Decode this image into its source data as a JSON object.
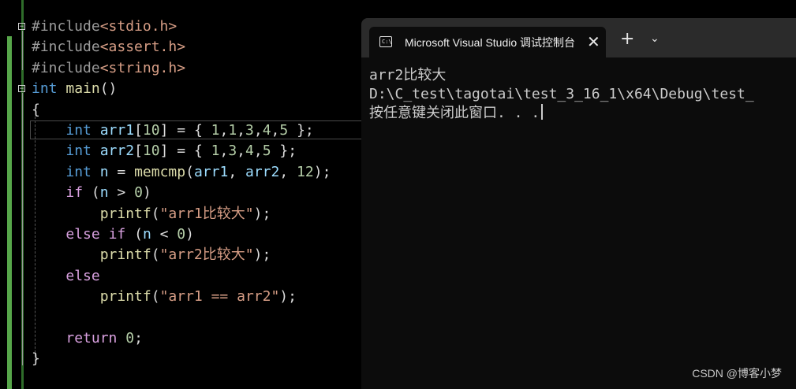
{
  "editor": {
    "lines": [
      {
        "parts": [
          [
            "pp",
            "#include"
          ],
          [
            "inc",
            "<stdio.h>"
          ]
        ]
      },
      {
        "parts": [
          [
            "pp",
            "#include"
          ],
          [
            "inc",
            "<assert.h>"
          ]
        ]
      },
      {
        "parts": [
          [
            "pp",
            "#include"
          ],
          [
            "inc",
            "<string.h>"
          ]
        ]
      },
      {
        "parts": [
          [
            "kw",
            "int"
          ],
          [
            "pun",
            " "
          ],
          [
            "fn",
            "main"
          ],
          [
            "pun",
            "()"
          ]
        ]
      },
      {
        "parts": [
          [
            "pun",
            "{"
          ]
        ]
      },
      {
        "parts": [
          [
            "pun",
            "    "
          ],
          [
            "kw",
            "int"
          ],
          [
            "pun",
            " "
          ],
          [
            "var",
            "arr1"
          ],
          [
            "pun",
            "["
          ],
          [
            "num",
            "10"
          ],
          [
            "pun",
            "] = { "
          ],
          [
            "num",
            "1"
          ],
          [
            "pun",
            ","
          ],
          [
            "num",
            "1"
          ],
          [
            "pun",
            ","
          ],
          [
            "num",
            "3"
          ],
          [
            "pun",
            ","
          ],
          [
            "num",
            "4"
          ],
          [
            "pun",
            ","
          ],
          [
            "num",
            "5"
          ],
          [
            "pun",
            " };"
          ]
        ]
      },
      {
        "parts": [
          [
            "pun",
            "    "
          ],
          [
            "kw",
            "int"
          ],
          [
            "pun",
            " "
          ],
          [
            "var",
            "arr2"
          ],
          [
            "pun",
            "["
          ],
          [
            "num",
            "10"
          ],
          [
            "pun",
            "] = { "
          ],
          [
            "num",
            "1"
          ],
          [
            "pun",
            ","
          ],
          [
            "num",
            "3"
          ],
          [
            "pun",
            ","
          ],
          [
            "num",
            "4"
          ],
          [
            "pun",
            ","
          ],
          [
            "num",
            "5"
          ],
          [
            "pun",
            " };"
          ]
        ]
      },
      {
        "parts": [
          [
            "pun",
            "    "
          ],
          [
            "kw",
            "int"
          ],
          [
            "pun",
            " "
          ],
          [
            "var",
            "n"
          ],
          [
            "pun",
            " = "
          ],
          [
            "fn",
            "memcmp"
          ],
          [
            "pun",
            "("
          ],
          [
            "var",
            "arr1"
          ],
          [
            "pun",
            ", "
          ],
          [
            "var",
            "arr2"
          ],
          [
            "pun",
            ", "
          ],
          [
            "num",
            "12"
          ],
          [
            "pun",
            ");"
          ]
        ]
      },
      {
        "parts": [
          [
            "pun",
            "    "
          ],
          [
            "ctrl",
            "if"
          ],
          [
            "pun",
            " ("
          ],
          [
            "var",
            "n"
          ],
          [
            "pun",
            " > "
          ],
          [
            "num",
            "0"
          ],
          [
            "pun",
            ")"
          ]
        ]
      },
      {
        "parts": [
          [
            "pun",
            "        "
          ],
          [
            "fn",
            "printf"
          ],
          [
            "pun",
            "("
          ],
          [
            "str",
            "\"arr1比较大\""
          ],
          [
            "pun",
            ");"
          ]
        ]
      },
      {
        "parts": [
          [
            "pun",
            "    "
          ],
          [
            "ctrl",
            "else"
          ],
          [
            "pun",
            " "
          ],
          [
            "ctrl",
            "if"
          ],
          [
            "pun",
            " ("
          ],
          [
            "var",
            "n"
          ],
          [
            "pun",
            " < "
          ],
          [
            "num",
            "0"
          ],
          [
            "pun",
            ")"
          ]
        ]
      },
      {
        "parts": [
          [
            "pun",
            "        "
          ],
          [
            "fn",
            "printf"
          ],
          [
            "pun",
            "("
          ],
          [
            "str",
            "\"arr2比较大\""
          ],
          [
            "pun",
            ");"
          ]
        ]
      },
      {
        "parts": [
          [
            "pun",
            "    "
          ],
          [
            "ctrl",
            "else"
          ]
        ]
      },
      {
        "parts": [
          [
            "pun",
            "        "
          ],
          [
            "fn",
            "printf"
          ],
          [
            "pun",
            "("
          ],
          [
            "str",
            "\"arr1 == arr2\""
          ],
          [
            "pun",
            ");"
          ]
        ]
      },
      {
        "parts": []
      },
      {
        "parts": [
          [
            "pun",
            "    "
          ],
          [
            "ctrl",
            "return"
          ],
          [
            "pun",
            " "
          ],
          [
            "num",
            "0"
          ],
          [
            "pun",
            ";"
          ]
        ]
      },
      {
        "parts": [
          [
            "pun",
            "}"
          ]
        ]
      }
    ],
    "fold_glyph": "−"
  },
  "terminal": {
    "tab_icon_text": "C:\\",
    "tab_title": "Microsoft Visual Studio 调试控制台",
    "close_glyph": "✕",
    "new_tab_glyph": "+",
    "dropdown_glyph": "⌄",
    "output": [
      "arr2比较大",
      "D:\\C_test\\tagotai\\test_3_16_1\\x64\\Debug\\test_",
      "按任意键关闭此窗口. . ."
    ]
  },
  "watermark": "CSDN @博客小梦",
  "colors": {
    "editor_bg": "#000000",
    "keyword": "#569cd6",
    "control": "#d8a0df",
    "string": "#d69d85",
    "number": "#b5cea8",
    "function": "#dcdcaa",
    "variable": "#9cdcfe",
    "terminal_bg": "#0c0c0c",
    "titlebar_bg": "#2b2b2b",
    "change_bar": "#57a64a"
  }
}
